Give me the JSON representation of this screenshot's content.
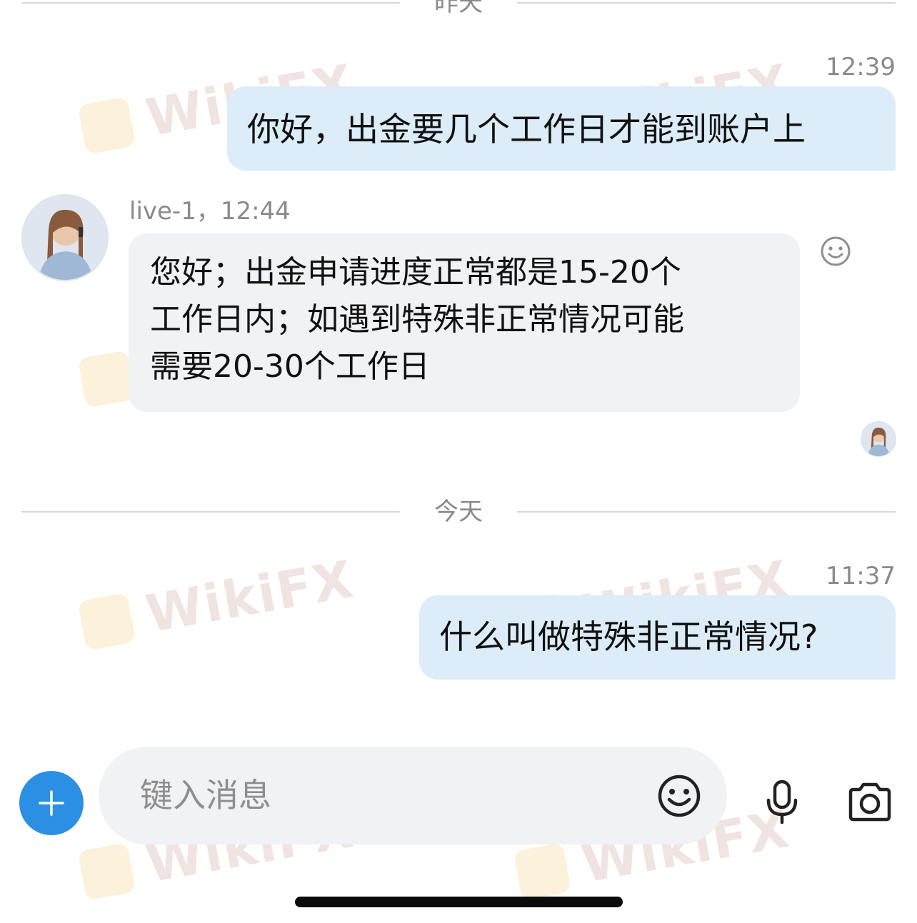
{
  "dividers": {
    "yesterday": "昨天",
    "today": "今天"
  },
  "messages": [
    {
      "id": "m1",
      "direction": "out",
      "time": "12:39",
      "text": "你好，出金要几个工作日才能到账户上"
    },
    {
      "id": "m2",
      "direction": "in",
      "sender_line": "live-1，12:44",
      "lines": [
        "您好；出金申请进度正常都是15-20个",
        "工作日内；如遇到特殊非正常情况可能",
        "需要20-30个工作日"
      ]
    },
    {
      "id": "m3",
      "direction": "out",
      "time": "11:37",
      "text": "什么叫做特殊非正常情况?"
    }
  ],
  "composer": {
    "placeholder": "键入消息"
  },
  "watermark": "WikiFX",
  "icons": {
    "add": "plus-icon",
    "emoji": "smiley-icon",
    "mic": "microphone-icon",
    "camera": "camera-icon",
    "reaction": "smiley-icon",
    "read_receipt": "avatar"
  },
  "colors": {
    "outgoing_bubble": "#dcedf9",
    "incoming_bubble": "#f1f2f4",
    "add_button": "#2b8fe3",
    "meta_text": "#8a8a8a"
  }
}
